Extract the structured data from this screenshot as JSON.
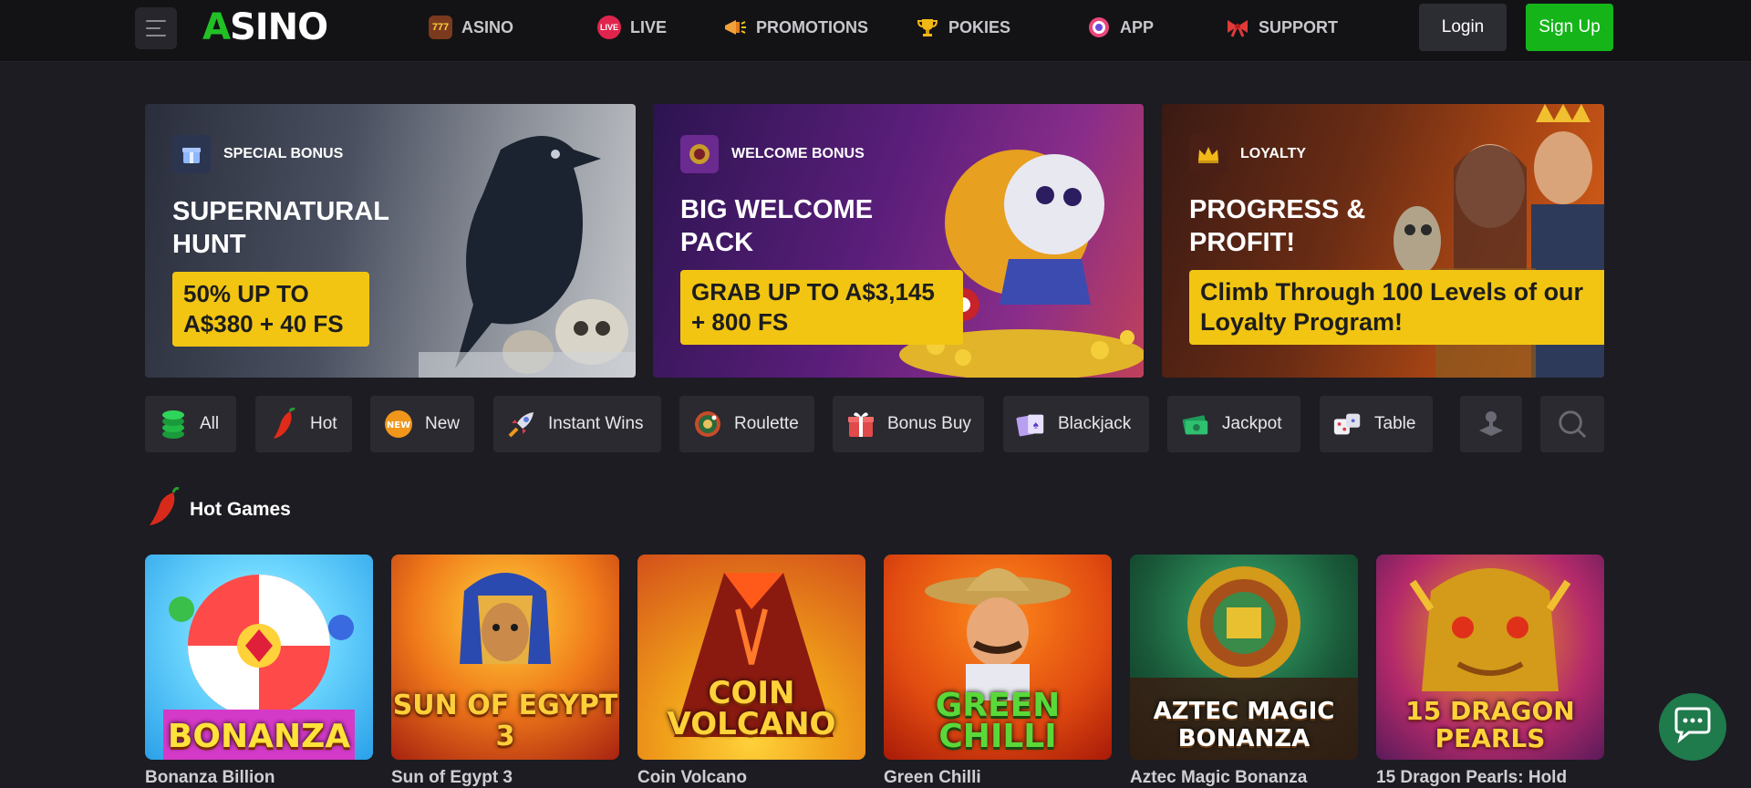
{
  "brand": {
    "logo_text": "SINO",
    "logo_mark": "A",
    "accent": "#15b51a"
  },
  "nav": [
    {
      "label": "ASINO",
      "icon": "slot-777-icon"
    },
    {
      "label": "LIVE",
      "icon": "live-badge-icon"
    },
    {
      "label": "PROMOTIONS",
      "icon": "megaphone-icon"
    },
    {
      "label": "POKIES",
      "icon": "trophy-icon"
    },
    {
      "label": "APP",
      "icon": "target-icon"
    },
    {
      "label": "SUPPORT",
      "icon": "bow-icon"
    }
  ],
  "auth": {
    "login": "Login",
    "signup": "Sign Up"
  },
  "banners": [
    {
      "tag": "SPECIAL BONUS",
      "title": "SUPERNATURAL HUNT",
      "offer": "50% UP TO A$380 + 40 FS"
    },
    {
      "tag": "WELCOME BONUS",
      "title": "BIG WELCOME PACK",
      "offer": "GRAB UP TO A$3,145 + 800 FS"
    },
    {
      "tag": "LOYALTY",
      "title": "PROGRESS & PROFIT!",
      "offer": "Climb Through 100 Levels of our Loyalty Program!"
    }
  ],
  "categories": [
    {
      "label": "All",
      "icon": "chips-stack-icon"
    },
    {
      "label": "Hot",
      "icon": "chili-icon"
    },
    {
      "label": "New",
      "icon": "new-badge-icon"
    },
    {
      "label": "Instant Wins",
      "icon": "rocket-icon"
    },
    {
      "label": "Roulette",
      "icon": "roulette-icon"
    },
    {
      "label": "Bonus Buy",
      "icon": "gift-icon"
    },
    {
      "label": "Blackjack",
      "icon": "cards-icon"
    },
    {
      "label": "Jackpot",
      "icon": "money-icon"
    },
    {
      "label": "Table",
      "icon": "dice-icon"
    }
  ],
  "section": {
    "title": "Hot Games"
  },
  "games": [
    {
      "title": "Bonanza Billion",
      "art": "BONANZA"
    },
    {
      "title": "Sun of Egypt 3",
      "art": "SUN OF EGYPT 3"
    },
    {
      "title": "Coin Volcano",
      "art": "COIN VOLCANO"
    },
    {
      "title": "Green Chilli",
      "art": "GREEN CHILLI"
    },
    {
      "title": "Aztec Magic Bonanza",
      "art": "AZTEC MAGIC BONANZA"
    },
    {
      "title": "15 Dragon Pearls: Hold",
      "art": "15 DRAGON PEARLS"
    }
  ]
}
